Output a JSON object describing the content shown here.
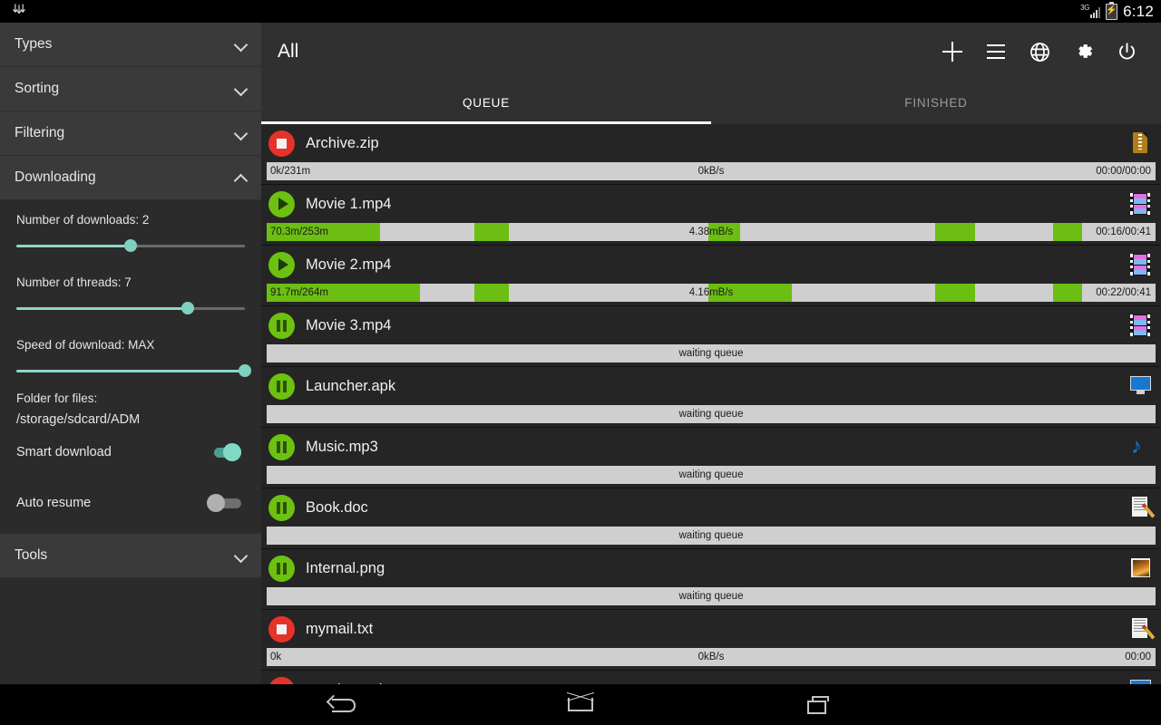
{
  "status_bar": {
    "download_icon": "download-arrows-icon",
    "network_type": "3G",
    "battery_icon": "battery-charging-icon",
    "time": "6:12"
  },
  "sidebar": {
    "sections": [
      {
        "label": "Types",
        "expanded": false
      },
      {
        "label": "Sorting",
        "expanded": false
      },
      {
        "label": "Filtering",
        "expanded": false
      },
      {
        "label": "Downloading",
        "expanded": true
      },
      {
        "label": "Tools",
        "expanded": false
      }
    ],
    "downloading": {
      "sliders": [
        {
          "label": "Number of downloads: 2",
          "value_percent": 50
        },
        {
          "label": "Number of threads: 7",
          "value_percent": 75
        },
        {
          "label": "Speed of download: MAX",
          "value_percent": 100
        }
      ],
      "folder_caption": "Folder for files:",
      "folder_path": "/storage/sdcard/ADM",
      "toggles": [
        {
          "label": "Smart download",
          "on": true
        },
        {
          "label": "Auto resume",
          "on": false
        }
      ]
    },
    "accent_color": "#7fd0c0"
  },
  "appbar": {
    "title": "All",
    "actions": [
      {
        "name": "add-download-button",
        "icon": "plus-icon"
      },
      {
        "name": "list-button",
        "icon": "list-icon"
      },
      {
        "name": "browser-button",
        "icon": "globe-icon"
      },
      {
        "name": "settings-button",
        "icon": "gear-icon"
      },
      {
        "name": "power-button",
        "icon": "power-icon"
      }
    ]
  },
  "tabs": [
    {
      "label": "QUEUE",
      "active": true
    },
    {
      "label": "FINISHED",
      "active": false
    }
  ],
  "downloads": [
    {
      "name": "Archive.zip",
      "state": "stop",
      "filetype": "zip",
      "bar": {
        "kind": "progress",
        "left": "0k/231m",
        "mid": "0kB/s",
        "right": "00:00/00:00",
        "segments": []
      }
    },
    {
      "name": "Movie 1.mp4",
      "state": "play",
      "filetype": "film",
      "bar": {
        "kind": "progress",
        "left": "70.3m/253m",
        "mid": "4.38mB/s",
        "right": "00:16/00:41",
        "segments": [
          {
            "start": 0.0,
            "width": 0.128
          },
          {
            "start": 0.234,
            "width": 0.038
          },
          {
            "start": 0.497,
            "width": 0.036
          },
          {
            "start": 0.752,
            "width": 0.045
          },
          {
            "start": 0.885,
            "width": 0.032
          }
        ]
      }
    },
    {
      "name": "Movie 2.mp4",
      "state": "play",
      "filetype": "film",
      "bar": {
        "kind": "progress",
        "left": "91.7m/264m",
        "mid": "4.16mB/s",
        "right": "00:22/00:41",
        "segments": [
          {
            "start": 0.0,
            "width": 0.172
          },
          {
            "start": 0.234,
            "width": 0.038
          },
          {
            "start": 0.497,
            "width": 0.094
          },
          {
            "start": 0.752,
            "width": 0.045
          },
          {
            "start": 0.885,
            "width": 0.032
          }
        ]
      }
    },
    {
      "name": "Movie 3.mp4",
      "state": "pause",
      "filetype": "film",
      "bar": {
        "kind": "waiting",
        "mid": "waiting queue"
      }
    },
    {
      "name": "Launcher.apk",
      "state": "pause",
      "filetype": "monitor",
      "bar": {
        "kind": "waiting",
        "mid": "waiting queue"
      }
    },
    {
      "name": "Music.mp3",
      "state": "pause",
      "filetype": "music",
      "bar": {
        "kind": "waiting",
        "mid": "waiting queue"
      }
    },
    {
      "name": "Book.doc",
      "state": "pause",
      "filetype": "doc",
      "bar": {
        "kind": "waiting",
        "mid": "waiting queue"
      }
    },
    {
      "name": "Internal.png",
      "state": "pause",
      "filetype": "photo",
      "bar": {
        "kind": "waiting",
        "mid": "waiting queue"
      }
    },
    {
      "name": "mymail.txt",
      "state": "stop",
      "filetype": "doc",
      "bar": {
        "kind": "progress",
        "left": "0k",
        "mid": "0kB/s",
        "right": "00:00",
        "segments": []
      }
    },
    {
      "name": "weather.apk",
      "state": "stop",
      "filetype": "monitor",
      "bar": {
        "kind": "none"
      }
    }
  ],
  "navbar": [
    {
      "name": "nav-back-button",
      "icon": "back-arrow-icon"
    },
    {
      "name": "nav-home-button",
      "icon": "home-icon"
    },
    {
      "name": "nav-recents-button",
      "icon": "recents-icon"
    }
  ],
  "colors": {
    "progress_green": "#6cbe12",
    "stop_red": "#e63329",
    "play_green": "#6cc111",
    "track_gray": "#cfcfcf"
  }
}
